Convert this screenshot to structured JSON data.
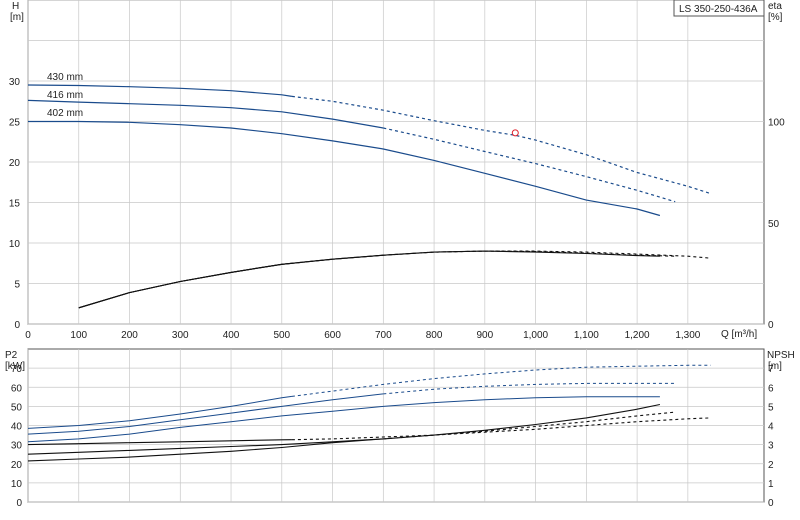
{
  "title_box": "LS 350-250-436A",
  "colors": {
    "curve_blue": "#1a4b8c",
    "curve_black": "#111111",
    "grid": "#c8c8c8",
    "marker": "#e0202a"
  },
  "top": {
    "y_left_label": "H",
    "y_left_unit": "[m]",
    "y_right_label": "eta",
    "y_right_unit": "[%]",
    "x_label": "Q [m³/h]",
    "x_ticks": [
      "0",
      "100",
      "200",
      "300",
      "400",
      "500",
      "600",
      "700",
      "800",
      "900",
      "1,000",
      "1,100",
      "1,200",
      "1,300"
    ],
    "y_left_ticks": [
      "0",
      "5",
      "10",
      "15",
      "20",
      "25",
      "30"
    ],
    "y_right_ticks": [
      "0",
      "50",
      "100"
    ]
  },
  "bottom": {
    "y_left_label": "P2",
    "y_left_unit": "[kW]",
    "y_right_label": "NPSH",
    "y_right_unit": "[m]",
    "y_left_ticks": [
      "0",
      "10",
      "20",
      "30",
      "40",
      "50",
      "60",
      "70"
    ],
    "y_right_ticks": [
      "0",
      "1",
      "2",
      "3",
      "4",
      "5",
      "6",
      "7"
    ]
  },
  "chart_data": [
    {
      "type": "line",
      "xlabel": "Q [m³/h]",
      "ylabel": "H [m]",
      "y2label": "eta [%]",
      "xlim": [
        0,
        1450
      ],
      "ylim": [
        0,
        40
      ],
      "y2lim": [
        0,
        160
      ],
      "grid": true,
      "series": [
        {
          "name": "430 mm",
          "axis": "H",
          "x": [
            0,
            100,
            200,
            300,
            400,
            500,
            520,
            600,
            700,
            800,
            900,
            960,
            1000,
            1100,
            1200,
            1300,
            1345
          ],
          "y": [
            29.5,
            29.45,
            29.3,
            29.1,
            28.8,
            28.3,
            28.1,
            27.5,
            26.4,
            25.1,
            23.9,
            23.3,
            22.7,
            20.9,
            18.7,
            17.0,
            16.1
          ],
          "solid_until": 520
        },
        {
          "name": "416 mm",
          "axis": "H",
          "x": [
            0,
            100,
            200,
            300,
            400,
            500,
            600,
            700,
            800,
            900,
            1000,
            1100,
            1200,
            1275
          ],
          "y": [
            27.6,
            27.4,
            27.2,
            27.0,
            26.7,
            26.2,
            25.3,
            24.2,
            22.8,
            21.3,
            19.8,
            18.2,
            16.5,
            15.1
          ],
          "solid_until": 700
        },
        {
          "name": "402 mm",
          "axis": "H",
          "x": [
            0,
            100,
            200,
            300,
            400,
            500,
            600,
            700,
            800,
            900,
            1000,
            1100,
            1200,
            1245
          ],
          "y": [
            25.0,
            25.0,
            24.9,
            24.6,
            24.2,
            23.5,
            22.6,
            21.6,
            20.2,
            18.6,
            17.0,
            15.3,
            14.2,
            13.4
          ],
          "solid_until": 1245
        },
        {
          "name": "eta 430 mm",
          "axis": "eta",
          "x": [
            100,
            200,
            300,
            400,
            500,
            600,
            700,
            800,
            900,
            1000,
            1100,
            1200,
            1300,
            1345
          ],
          "y": [
            8,
            15.5,
            21,
            25.5,
            29.5,
            32,
            34,
            35.5,
            36,
            36,
            35.5,
            34.5,
            33.5,
            32.5
          ],
          "solid_until": 520
        },
        {
          "name": "eta 416 mm",
          "axis": "eta",
          "x": [
            100,
            200,
            300,
            400,
            500,
            600,
            700,
            800,
            900,
            1000,
            1100,
            1200,
            1275
          ],
          "y": [
            8,
            15.5,
            21,
            25.5,
            29.5,
            32,
            34,
            35.5,
            36,
            35.8,
            35,
            34,
            33.5
          ],
          "solid_until": 700
        },
        {
          "name": "eta 402 mm",
          "axis": "eta",
          "x": [
            100,
            200,
            300,
            400,
            500,
            600,
            700,
            800,
            900,
            1000,
            1100,
            1200,
            1245
          ],
          "y": [
            8,
            15.5,
            21,
            25.5,
            29.5,
            32,
            34,
            35.5,
            36,
            35.5,
            34.8,
            33.8,
            33.5
          ],
          "solid_until": 1245
        }
      ],
      "series_labels": [
        "430 mm",
        "416 mm",
        "402 mm"
      ],
      "marker": {
        "x": 960,
        "y": 23.6
      }
    },
    {
      "type": "line",
      "ylabel": "P2 [kW]",
      "y2label": "NPSH [m]",
      "xlim": [
        0,
        1450
      ],
      "ylim": [
        0,
        80
      ],
      "y2lim": [
        0,
        8
      ],
      "grid": true,
      "series": [
        {
          "name": "P2 430 mm",
          "axis": "P2",
          "x": [
            0,
            100,
            200,
            300,
            400,
            500,
            600,
            700,
            800,
            900,
            1000,
            1100,
            1200,
            1300,
            1345
          ],
          "y": [
            38.5,
            40,
            42.5,
            46,
            50,
            54.5,
            58,
            61.5,
            64.5,
            67,
            69,
            70.5,
            71,
            71.5,
            71.5
          ],
          "solid_until": 520
        },
        {
          "name": "P2 416 mm",
          "axis": "P2",
          "x": [
            0,
            100,
            200,
            300,
            400,
            500,
            600,
            700,
            800,
            900,
            1000,
            1100,
            1200,
            1275
          ],
          "y": [
            35.5,
            37,
            39.5,
            43,
            46.5,
            50,
            53.5,
            56.5,
            59,
            60.5,
            61.5,
            62,
            62,
            62
          ],
          "solid_until": 700
        },
        {
          "name": "P2 402 mm",
          "axis": "P2",
          "x": [
            0,
            100,
            200,
            300,
            400,
            500,
            600,
            700,
            800,
            900,
            1000,
            1100,
            1200,
            1245
          ],
          "y": [
            31.5,
            33,
            35.5,
            39,
            42,
            45,
            47.5,
            50,
            52,
            53.5,
            54.5,
            55,
            55,
            55
          ],
          "solid_until": 1245
        },
        {
          "name": "NPSH 430 mm",
          "axis": "NPSH",
          "x": [
            0,
            100,
            200,
            300,
            400,
            500,
            600,
            700,
            800,
            900,
            1000,
            1100,
            1200,
            1300,
            1345
          ],
          "y": [
            3.0,
            3.05,
            3.1,
            3.15,
            3.2,
            3.25,
            3.3,
            3.4,
            3.5,
            3.65,
            3.8,
            4.0,
            4.2,
            4.35,
            4.4
          ],
          "solid_until": 520
        },
        {
          "name": "NPSH 416 mm",
          "axis": "NPSH",
          "x": [
            0,
            100,
            200,
            300,
            400,
            500,
            600,
            700,
            800,
            900,
            1000,
            1100,
            1200,
            1275
          ],
          "y": [
            2.5,
            2.6,
            2.7,
            2.8,
            2.9,
            3.0,
            3.15,
            3.3,
            3.5,
            3.7,
            3.95,
            4.2,
            4.5,
            4.7
          ],
          "solid_until": 700
        },
        {
          "name": "NPSH 402 mm",
          "axis": "NPSH",
          "x": [
            0,
            100,
            200,
            300,
            400,
            500,
            600,
            700,
            800,
            900,
            1000,
            1100,
            1200,
            1245
          ],
          "y": [
            2.15,
            2.25,
            2.35,
            2.5,
            2.65,
            2.85,
            3.1,
            3.3,
            3.5,
            3.75,
            4.05,
            4.4,
            4.85,
            5.1
          ],
          "solid_until": 1245
        }
      ]
    }
  ]
}
